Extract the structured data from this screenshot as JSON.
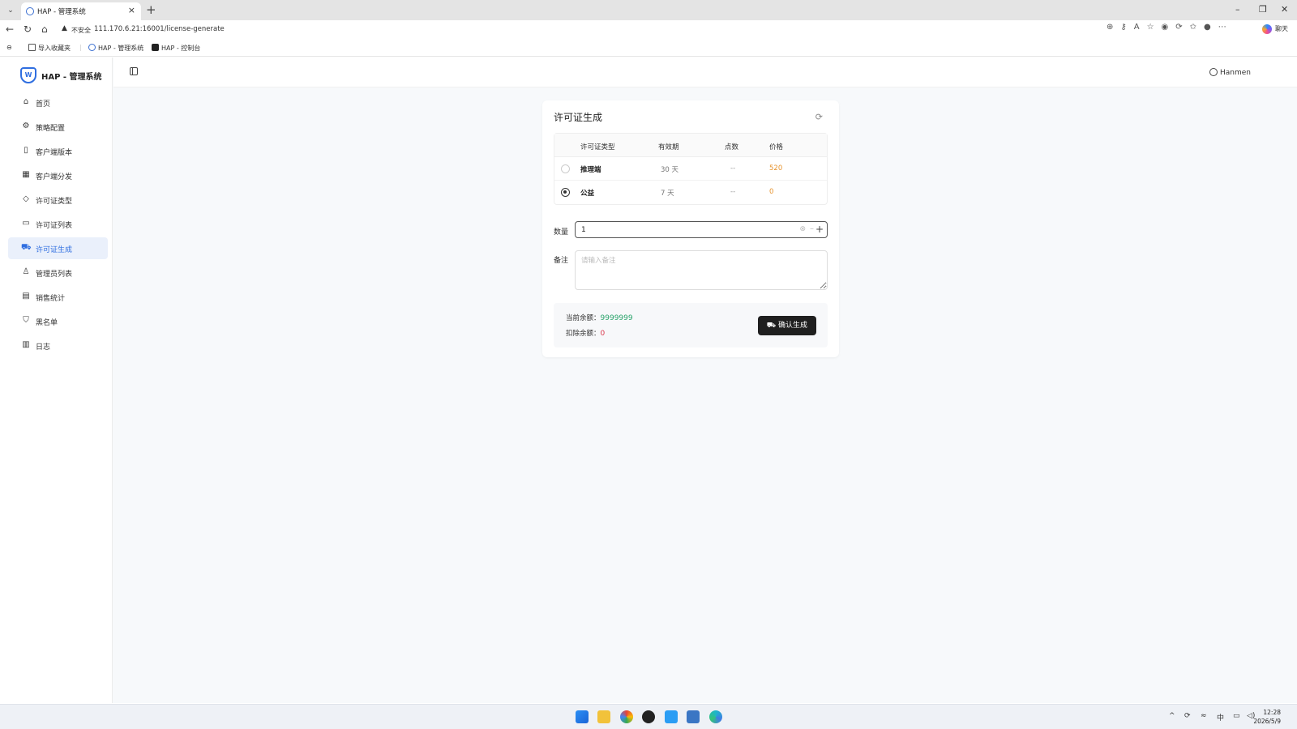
{
  "browser": {
    "tab_title": "HAP - 管理系统",
    "url_warning": "不安全",
    "url": "111.170.6.21:16001/license-generate",
    "chat_label": "聊天",
    "bookmarks": {
      "import": "导入收藏夹",
      "bm1": "HAP - 管理系统",
      "bm2": "HAP - 控制台"
    }
  },
  "app": {
    "title": "HAP - 管理系统",
    "user": "Hanmen"
  },
  "sidebar": {
    "items": [
      {
        "label": "首页",
        "icon": "home-icon"
      },
      {
        "label": "策略配置",
        "icon": "gear-icon"
      },
      {
        "label": "客户端版本",
        "icon": "version-icon"
      },
      {
        "label": "客户端分发",
        "icon": "distribute-icon"
      },
      {
        "label": "许可证类型",
        "icon": "tag-icon"
      },
      {
        "label": "许可证列表",
        "icon": "card-icon"
      },
      {
        "label": "许可证生成",
        "icon": "cart-icon",
        "active": true
      },
      {
        "label": "管理员列表",
        "icon": "user-icon"
      },
      {
        "label": "销售统计",
        "icon": "clipboard-icon"
      },
      {
        "label": "黑名单",
        "icon": "shield-icon"
      },
      {
        "label": "日志",
        "icon": "file-icon"
      }
    ]
  },
  "card": {
    "title": "许可证生成",
    "columns": [
      "许可证类型",
      "有效期",
      "点数",
      "价格"
    ],
    "rows": [
      {
        "name": "推理端",
        "days": "30 天",
        "points": "--",
        "price": "520",
        "selected": false
      },
      {
        "name": "公益",
        "days": "7 天",
        "points": "--",
        "price": "0",
        "selected": true
      }
    ],
    "quantity_label": "数量",
    "quantity_value": "1",
    "note_label": "备注",
    "note_placeholder": "请输入备注",
    "balance_label": "当前余额：",
    "balance_value": "9999999",
    "deduct_label": "扣除余额：",
    "deduct_value": "0",
    "confirm_label": "确认生成"
  },
  "taskbar": {
    "time": "12:28",
    "date": "2026/5/9",
    "ime": "中"
  },
  "colors": {
    "accent": "#2f6ee0",
    "price": "#e6932e",
    "balance": "#29a36a",
    "deduct": "#d9364a",
    "button": "#1f1f1f"
  }
}
